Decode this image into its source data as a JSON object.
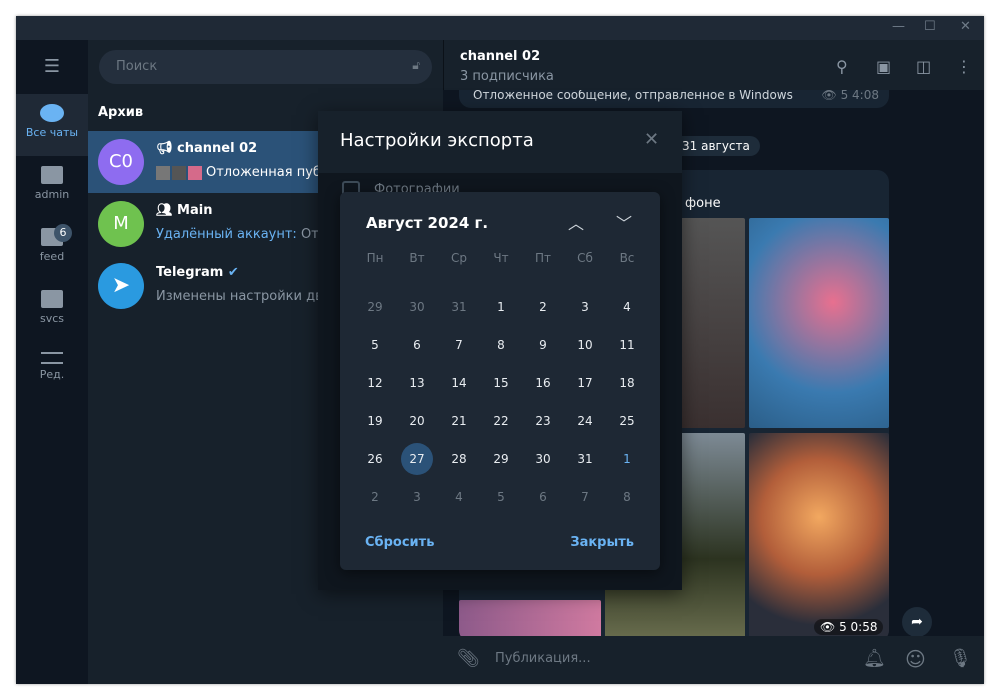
{
  "sidebar": {
    "items": [
      {
        "label": "Все чаты",
        "icon": "chats-icon",
        "active": true
      },
      {
        "label": "admin",
        "icon": "folder-icon"
      },
      {
        "label": "feed",
        "icon": "folder-icon",
        "badge": "6"
      },
      {
        "label": "svcs",
        "icon": "folder-icon"
      },
      {
        "label": "Ред.",
        "icon": "sliders-icon"
      }
    ]
  },
  "chatlist": {
    "search_placeholder": "Поиск",
    "section": "Архив",
    "chats": [
      {
        "avatar": "C0",
        "name": "channel 02",
        "preview": "Отложенная публ",
        "avatar_color": "#8e6cf0"
      },
      {
        "avatar": "M",
        "name": "Main",
        "sender": "Удалённый аккаунт:",
        "preview": " Отлож",
        "avatar_color": "#6fc24f"
      },
      {
        "name": "Telegram",
        "preview": "Изменены настройки двух",
        "avatar_color": "#2a9ae0"
      }
    ]
  },
  "chat": {
    "title": "channel 02",
    "subtitle": "3 подписчика",
    "prev_msg": "Отложенное сообщение, отправленное в Windows",
    "prev_views": "5",
    "prev_time": "4:08",
    "date_pill": "31 августа",
    "msg_text": "фоне",
    "album_views": "5",
    "album_time": "0:58",
    "composer_placeholder": "Публикация..."
  },
  "dialog": {
    "title": "Настройки экспорта",
    "option": "Фотографии"
  },
  "calendar": {
    "month": "Август 2024 г.",
    "weekdays": [
      "Пн",
      "Вт",
      "Ср",
      "Чт",
      "Пт",
      "Сб",
      "Вс"
    ],
    "weeks": [
      [
        "29",
        "30",
        "31",
        "1",
        "2",
        "3",
        "4"
      ],
      [
        "5",
        "6",
        "7",
        "8",
        "9",
        "10",
        "11"
      ],
      [
        "12",
        "13",
        "14",
        "15",
        "16",
        "17",
        "18"
      ],
      [
        "19",
        "20",
        "21",
        "22",
        "23",
        "24",
        "25"
      ],
      [
        "26",
        "27",
        "28",
        "29",
        "30",
        "31",
        "1"
      ],
      [
        "2",
        "3",
        "4",
        "5",
        "6",
        "7",
        "8"
      ]
    ],
    "selected": "27",
    "reset": "Сбросить",
    "close": "Закрыть"
  }
}
